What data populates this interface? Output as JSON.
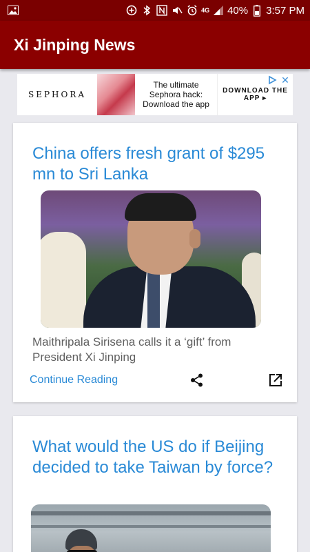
{
  "status_bar": {
    "battery": "40%",
    "time": "3:57 PM",
    "network": "4G"
  },
  "app_bar": {
    "title": "Xi Jinping News"
  },
  "ad": {
    "brand": "SEPHORA",
    "text": "The ultimate Sephora hack: Download the app",
    "cta": "DOWNLOAD THE APP ▸"
  },
  "articles": [
    {
      "headline": "China offers fresh grant of $295 mn to Sri Lanka",
      "summary": "Maithripala Sirisena calls it a ‘gift’ from President Xi Jinping",
      "continue_label": "Continue Reading"
    },
    {
      "headline": "What would the US do if Beijing decided to take Taiwan by force?"
    }
  ],
  "colors": {
    "app_bar": "#8b0000",
    "status_bar": "#7a0000",
    "link": "#2a8ad6",
    "background": "#e9e9ee"
  }
}
